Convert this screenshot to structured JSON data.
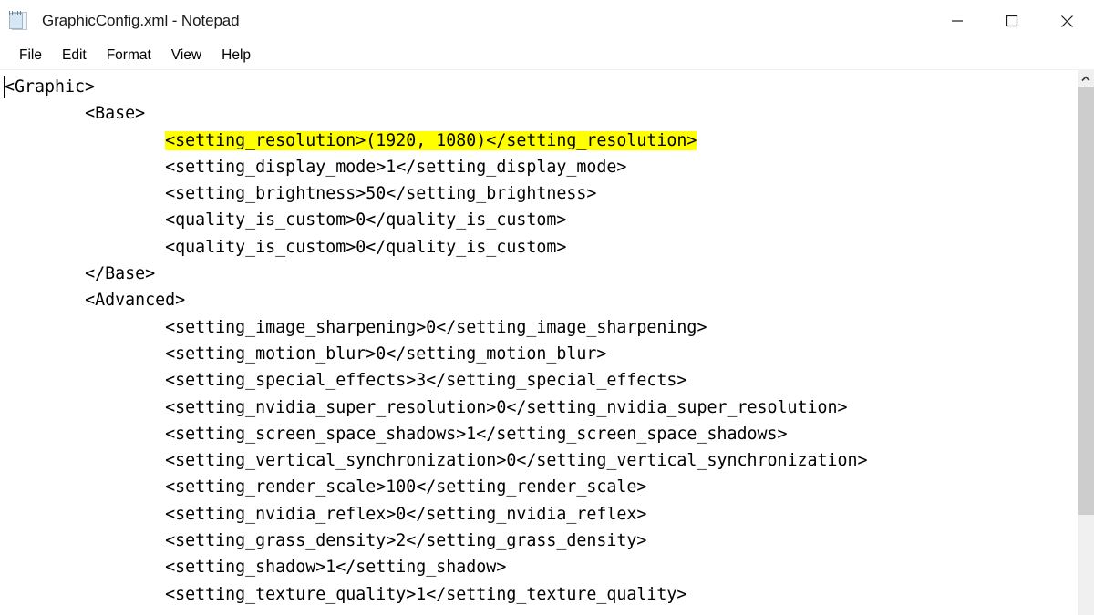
{
  "window": {
    "title": "GraphicConfig.xml - Notepad",
    "icon": "notepad-icon",
    "controls": {
      "minimize": "minimize-icon",
      "maximize": "maximize-icon",
      "close": "close-icon"
    }
  },
  "menubar": {
    "items": [
      {
        "label": "File"
      },
      {
        "label": "Edit"
      },
      {
        "label": "Format"
      },
      {
        "label": "View"
      },
      {
        "label": "Help"
      }
    ]
  },
  "editor": {
    "highlight_color": "#ffff00",
    "caret_visible": true,
    "lines": [
      {
        "indent": 0,
        "text": "<Graphic>",
        "highlighted": false
      },
      {
        "indent": 1,
        "text": "<Base>",
        "highlighted": false
      },
      {
        "indent": 2,
        "text": "<setting_resolution>(1920, 1080)</setting_resolution>",
        "highlighted": true
      },
      {
        "indent": 2,
        "text": "<setting_display_mode>1</setting_display_mode>",
        "highlighted": false
      },
      {
        "indent": 2,
        "text": "<setting_brightness>50</setting_brightness>",
        "highlighted": false
      },
      {
        "indent": 2,
        "text": "<quality_is_custom>0</quality_is_custom>",
        "highlighted": false
      },
      {
        "indent": 2,
        "text": "<quality_is_custom>0</quality_is_custom>",
        "highlighted": false
      },
      {
        "indent": 1,
        "text": "</Base>",
        "highlighted": false
      },
      {
        "indent": 1,
        "text": "<Advanced>",
        "highlighted": false
      },
      {
        "indent": 2,
        "text": "<setting_image_sharpening>0</setting_image_sharpening>",
        "highlighted": false
      },
      {
        "indent": 2,
        "text": "<setting_motion_blur>0</setting_motion_blur>",
        "highlighted": false
      },
      {
        "indent": 2,
        "text": "<setting_special_effects>3</setting_special_effects>",
        "highlighted": false
      },
      {
        "indent": 2,
        "text": "<setting_nvidia_super_resolution>0</setting_nvidia_super_resolution>",
        "highlighted": false
      },
      {
        "indent": 2,
        "text": "<setting_screen_space_shadows>1</setting_screen_space_shadows>",
        "highlighted": false
      },
      {
        "indent": 2,
        "text": "<setting_vertical_synchronization>0</setting_vertical_synchronization>",
        "highlighted": false
      },
      {
        "indent": 2,
        "text": "<setting_render_scale>100</setting_render_scale>",
        "highlighted": false
      },
      {
        "indent": 2,
        "text": "<setting_nvidia_reflex>0</setting_nvidia_reflex>",
        "highlighted": false
      },
      {
        "indent": 2,
        "text": "<setting_grass_density>2</setting_grass_density>",
        "highlighted": false
      },
      {
        "indent": 2,
        "text": "<setting_shadow>1</setting_shadow>",
        "highlighted": false
      },
      {
        "indent": 2,
        "text": "<setting_texture_quality>1</setting_texture_quality>",
        "highlighted": false
      }
    ]
  },
  "scrollbar": {
    "up_arrow": "chevron-up-icon",
    "thumb_color": "#cdcdcd",
    "track_color": "#f0f0f0"
  }
}
